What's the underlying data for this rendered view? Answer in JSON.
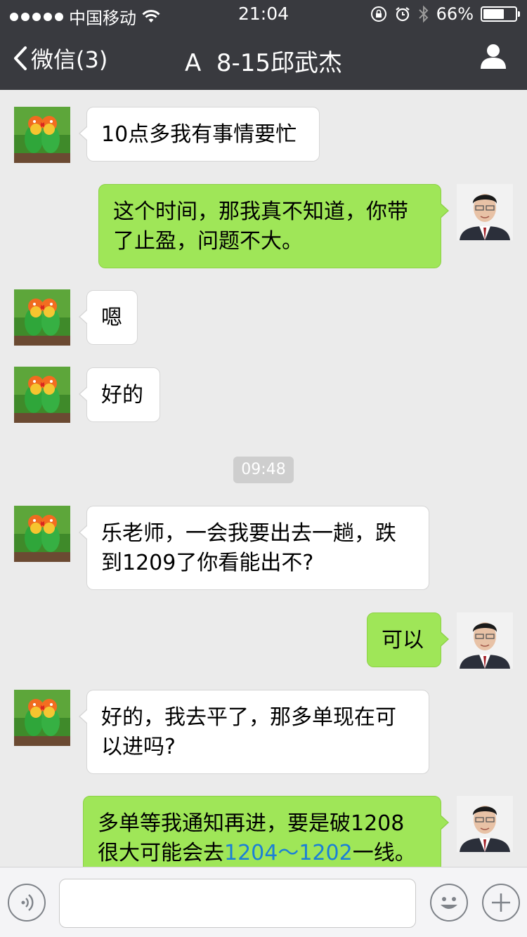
{
  "status_bar": {
    "carrier": "中国移动",
    "time": "21:04",
    "battery_text": "66%",
    "battery_level": 0.66
  },
  "nav": {
    "back_label": "微信(3)",
    "title": "A  8-15邱武杰"
  },
  "chat": {
    "messages": [
      {
        "side": "in",
        "text": "10点多我有事情要忙"
      },
      {
        "side": "out",
        "line1": "这个时间，那我真不知道，你带",
        "line2": "了止盈，问题不大。"
      },
      {
        "side": "in",
        "text": "嗯"
      },
      {
        "side": "in",
        "text": "好的"
      },
      {
        "side": "in",
        "line1": "乐老师，一会我要出去一趟，跌",
        "line2": "到1209了你看能出不?"
      },
      {
        "side": "out",
        "text": "可以"
      },
      {
        "side": "in",
        "line1": "好的，我去平了，那多单现在可",
        "line2": "以进吗?"
      },
      {
        "side": "out",
        "line1": "多单等我通知再进，要是破1208",
        "line2_pre": "很大可能会去",
        "line2_link": "1204～1202",
        "line2_post": "一线。"
      }
    ],
    "timestamp": "09:48"
  },
  "input_bar": {
    "voice_icon": "voice-icon",
    "emoji_icon": "emoji-icon",
    "plus_icon": "plus-icon"
  },
  "colors": {
    "nav_bg": "#393a3f",
    "chat_bg": "#ebebeb",
    "outgoing_bubble": "#9fe658",
    "incoming_bubble": "#ffffff",
    "link": "#1a7fd8"
  }
}
